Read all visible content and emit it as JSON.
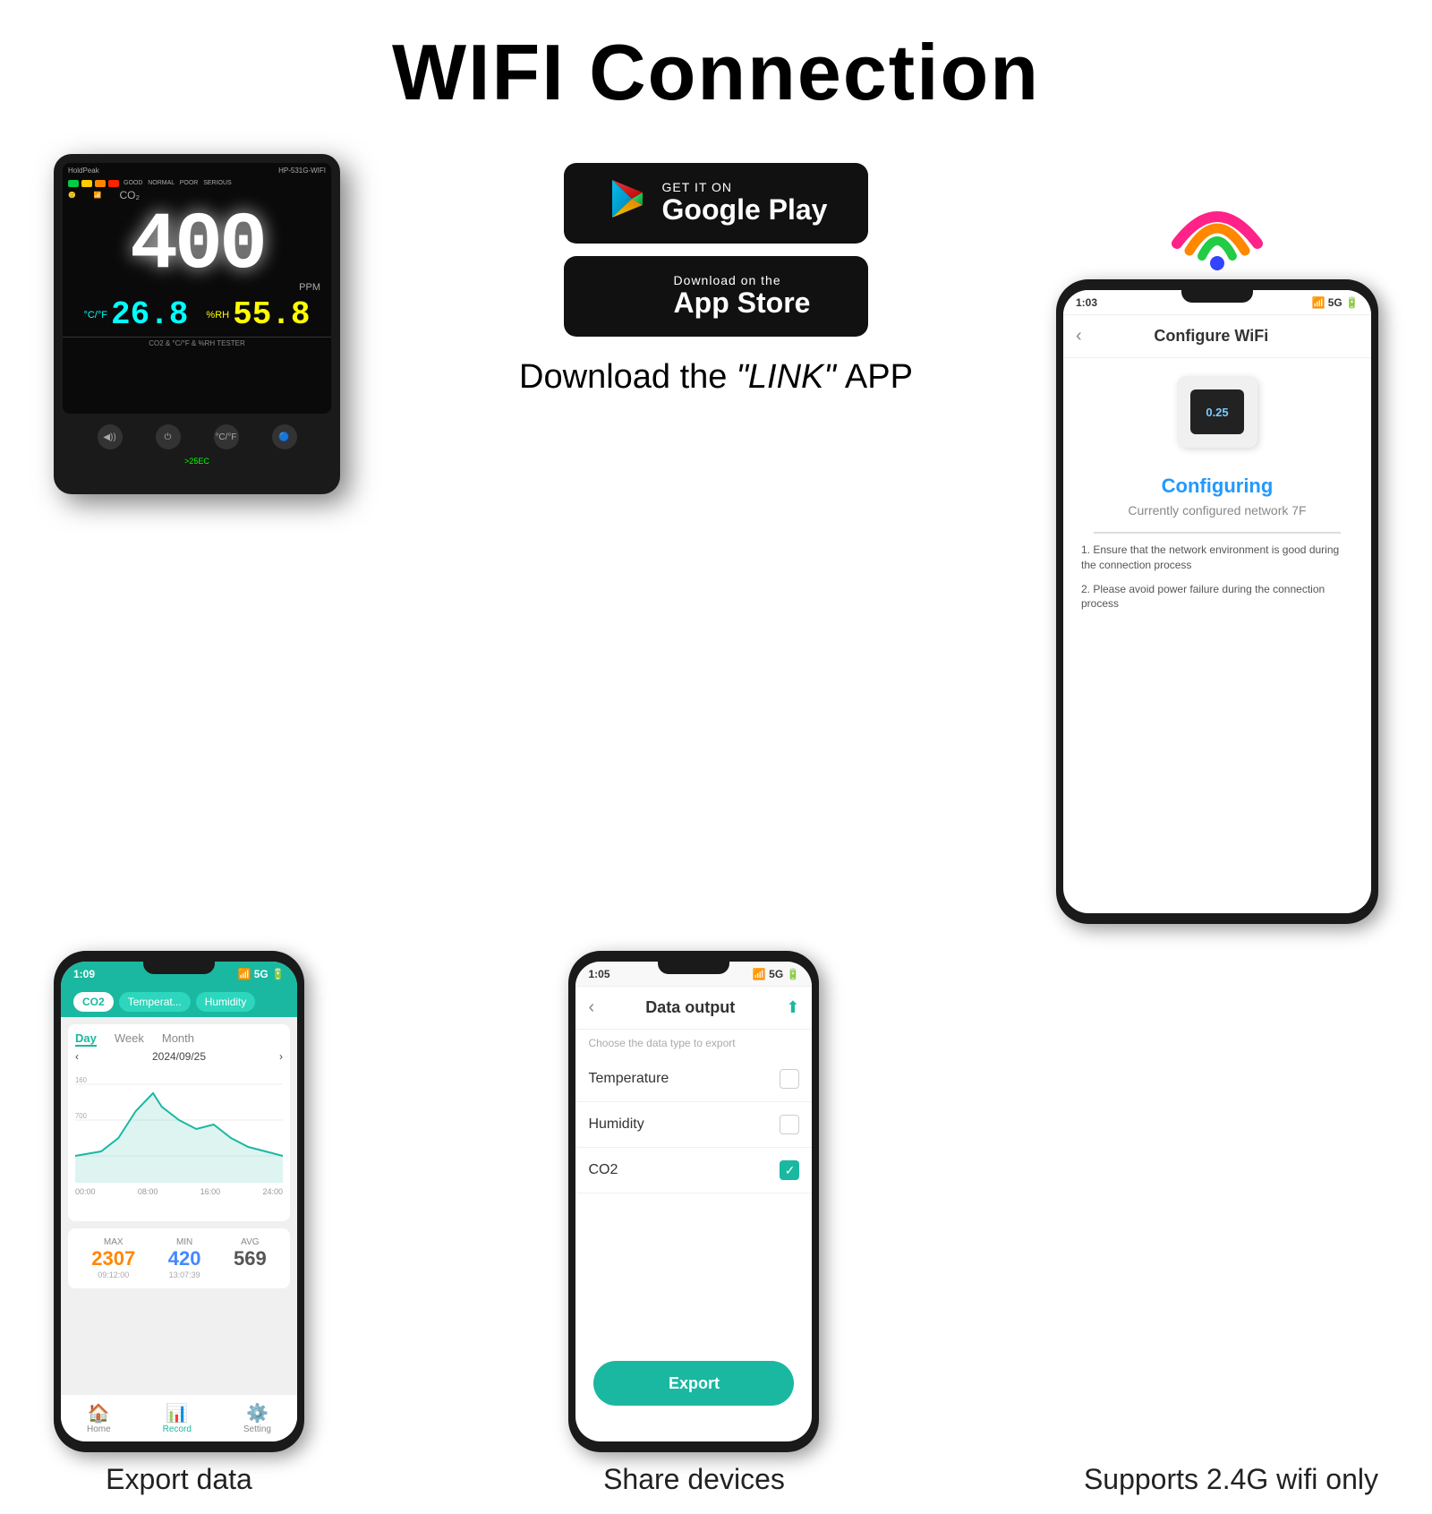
{
  "title": "WIFI Connection",
  "subtitle_download": "Download the",
  "subtitle_link": "\"LINK\"",
  "subtitle_app": "APP",
  "google_play": {
    "get_it_on": "GET IT ON",
    "store_name": "Google Play"
  },
  "app_store": {
    "download_on": "Download on the",
    "store_name": "App Store"
  },
  "device": {
    "brand": "HoldPeak",
    "model": "HP-531G-WIFI",
    "co2_value": "400",
    "co2_unit": "PPM",
    "temp_value": "26.8",
    "temp_unit": "°C/°F",
    "humid_value": "55.8",
    "humid_unit": "%RH",
    "bottom_text": "CO2 & °C/°F & %RH TESTER"
  },
  "phone1": {
    "time": "1:09",
    "signal": "5G",
    "tabs": [
      "CO2",
      "Temperat...",
      "Humidity"
    ],
    "active_tab": "CO2",
    "chart_tabs": [
      "Day",
      "Week",
      "Month"
    ],
    "active_chart_tab": "Day",
    "date": "2024/09/25",
    "stats": {
      "max_label": "MAX",
      "max_value": "2307",
      "max_time": "09:12:00",
      "min_label": "MIN",
      "min_value": "420",
      "min_time": "13:07:39",
      "avg_label": "AVG",
      "avg_value": "569"
    },
    "x_labels": [
      "00:00",
      "08:00",
      "16:00",
      "24:00"
    ],
    "y_labels": [
      "160",
      "700"
    ],
    "nav": [
      "Home",
      "Record",
      "Setting"
    ],
    "active_nav": "Record"
  },
  "phone2": {
    "time": "1:05",
    "signal": "5G",
    "title": "Data output",
    "subtitle": "Choose the data type to export",
    "options": [
      {
        "label": "Temperature",
        "checked": false
      },
      {
        "label": "Humidity",
        "checked": false
      },
      {
        "label": "CO2",
        "checked": true
      }
    ],
    "export_btn": "Export"
  },
  "phone3": {
    "time": "1:03",
    "signal": "5G",
    "title": "Configure WiFi",
    "device_value": "0.25",
    "status_label": "Configuring",
    "status_sub": "Currently configured network 7F",
    "instructions": [
      "1. Ensure that the network environment is good during the connection process",
      "2. Please avoid power failure during the connection process"
    ]
  },
  "captions": {
    "phone1": "Export data",
    "phone2": "Share devices",
    "phone3": "Supports 2.4G wifi only"
  }
}
